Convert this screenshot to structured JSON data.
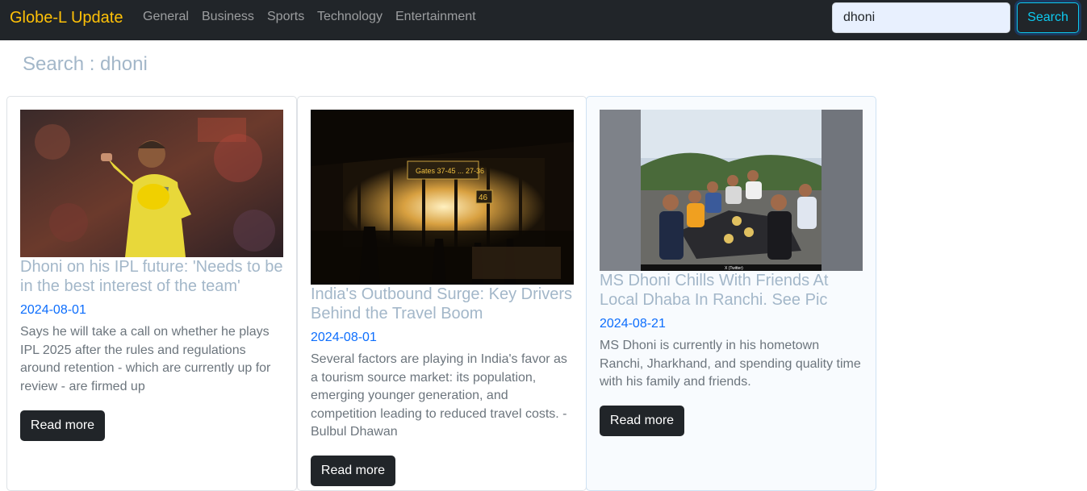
{
  "navbar": {
    "brand": "Globe-L Update",
    "links": [
      "General",
      "Business",
      "Sports",
      "Technology",
      "Entertainment"
    ],
    "search_value": "dhoni",
    "search_button": "Search"
  },
  "page": {
    "heading": "Search : dhoni"
  },
  "articles": [
    {
      "title": "Dhoni on his IPL future: 'Needs to be in the best interest of the team'",
      "date": "2024-08-01",
      "description": "Says he will take a call on whether he plays IPL 2025 after the rules and regulations around retention - which are currently up for review - are firmed up",
      "button": "Read more"
    },
    {
      "title": "India's Outbound Surge: Key Drivers Behind the Travel Boom",
      "date": "2024-08-01",
      "description": "Several factors are playing in India's favor as a tourism source market: its population, emerging younger generation, and competition leading to reduced travel costs. - Bulbul Dhawan",
      "button": "Read more",
      "image_sign": "Gates 37-45 ... 27-36",
      "image_gate": "46"
    },
    {
      "title": "MS Dhoni Chills With Friends At Local Dhaba In Ranchi. See Pic",
      "date": "2024-08-21",
      "description": "MS Dhoni is currently in his hometown Ranchi, Jharkhand, and spending quality time with his family and friends.",
      "button": "Read more",
      "image_caption": "X (Twitter)"
    }
  ]
}
